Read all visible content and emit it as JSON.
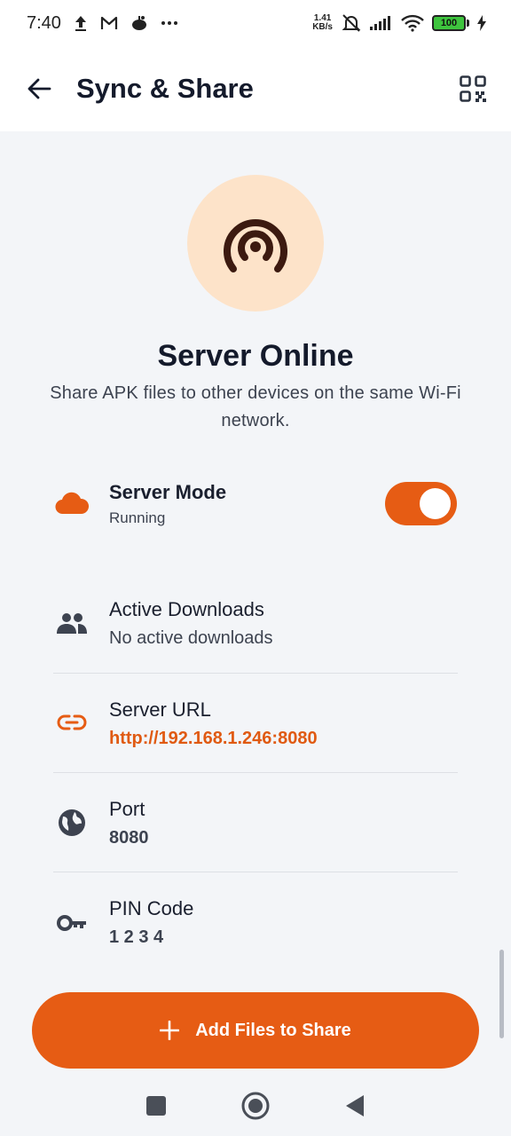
{
  "status_bar": {
    "time": "7:40",
    "speed_value": "1.41",
    "speed_unit": "KB/s",
    "battery": "100",
    "icons": [
      "upload-icon",
      "gmail-icon",
      "app-notification-icon",
      "more-notifications-icon",
      "mute-icon",
      "signal-icon",
      "wifi-icon",
      "battery-icon",
      "charging-icon"
    ]
  },
  "app_bar": {
    "title": "Sync & Share",
    "back_icon": "arrow-back-icon",
    "qr_icon": "qr-code-icon"
  },
  "hero": {
    "icon": "broadcast-icon",
    "title": "Server Online",
    "subtitle": "Share APK files to other devices on the same Wi-Fi network."
  },
  "server_mode": {
    "label": "Server Mode",
    "status": "Running",
    "enabled": true,
    "icon": "cloud-icon"
  },
  "info_rows": [
    {
      "label": "Active Downloads",
      "value": "No active downloads",
      "icon": "people-icon"
    },
    {
      "label": "Server URL",
      "value": "http://192.168.1.246:8080",
      "icon": "link-icon"
    },
    {
      "label": "Port",
      "value": "8080",
      "icon": "globe-icon"
    },
    {
      "label": "PIN Code",
      "value": "1 2 3 4",
      "icon": "key-icon"
    }
  ],
  "cta": {
    "label": "Add Files to Share",
    "icon": "plus-icon"
  },
  "colors": {
    "accent": "#e65c14",
    "hero_bg": "#fde3c9",
    "icon_dark": "#3c1a10",
    "background": "#f3f5f8"
  }
}
